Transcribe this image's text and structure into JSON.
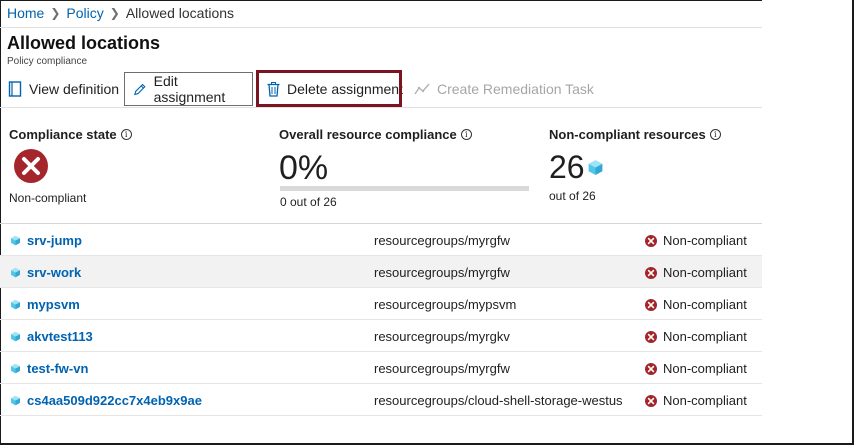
{
  "breadcrumb": {
    "home": "Home",
    "policy": "Policy",
    "current": "Allowed locations"
  },
  "page": {
    "title": "Allowed locations",
    "subtitle": "Policy compliance"
  },
  "toolbar": {
    "view_definition": "View definition",
    "edit_assignment": "Edit assignment",
    "delete_assignment": "Delete assignment",
    "create_remediation": "Create Remediation Task"
  },
  "metrics": {
    "compliance_state": {
      "label": "Compliance state",
      "value": "Non-compliant"
    },
    "overall": {
      "label": "Overall resource compliance",
      "percent": "0%",
      "fraction": 0,
      "sub": "0 out of 26"
    },
    "noncompliant": {
      "label": "Non-compliant resources",
      "count": "26",
      "sub": "out of 26"
    }
  },
  "colors": {
    "link": "#0063b1",
    "error": "#a4262c",
    "highlight": "#7a1421",
    "cube": "#50c7e9"
  },
  "resources": [
    {
      "name": "srv-jump",
      "resource_group": "resourcegroups/myrgfw",
      "status": "Non-compliant"
    },
    {
      "name": "srv-work",
      "resource_group": "resourcegroups/myrgfw",
      "status": "Non-compliant"
    },
    {
      "name": "mypsvm",
      "resource_group": "resourcegroups/mypsvm",
      "status": "Non-compliant"
    },
    {
      "name": "akvtest113",
      "resource_group": "resourcegroups/myrgkv",
      "status": "Non-compliant"
    },
    {
      "name": "test-fw-vn",
      "resource_group": "resourcegroups/myrgfw",
      "status": "Non-compliant"
    },
    {
      "name": "cs4aa509d922cc7x4eb9x9ae",
      "resource_group": "resourcegroups/cloud-shell-storage-westus",
      "status": "Non-compliant"
    }
  ]
}
